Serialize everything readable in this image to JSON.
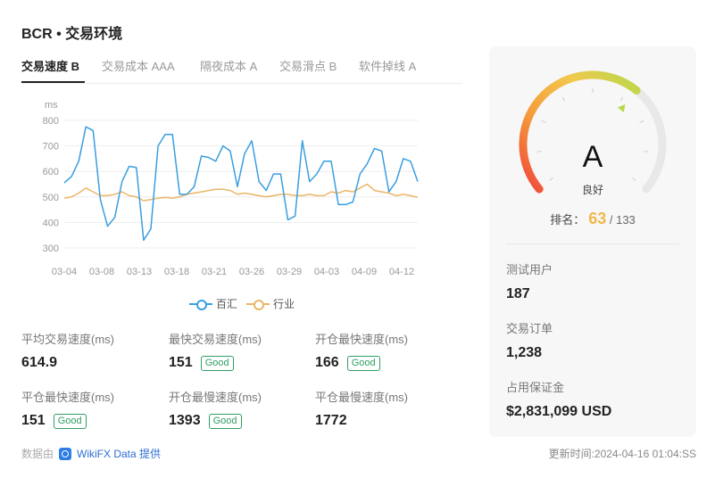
{
  "header": {
    "title": "BCR • 交易环境"
  },
  "tabs": [
    {
      "label": "交易速度 B",
      "active": true
    },
    {
      "label": "交易成本 AAA",
      "active": false
    },
    {
      "label": "隔夜成本 A",
      "active": false
    },
    {
      "label": "交易滑点 B",
      "active": false
    },
    {
      "label": "软件掉线 A",
      "active": false
    }
  ],
  "chart_data": {
    "type": "line",
    "ylabel": "ms",
    "ylim": [
      300,
      800
    ],
    "yticks": [
      800,
      700,
      600,
      500,
      400,
      300
    ],
    "xtick_labels": [
      "03-04",
      "03-08",
      "03-13",
      "03-18",
      "03-21",
      "03-26",
      "03-29",
      "04-03",
      "04-09",
      "04-12"
    ],
    "grid": "horizontal",
    "legend_position": "bottom",
    "series": [
      {
        "name": "百汇",
        "color": "#3a9ee0",
        "values": [
          555,
          580,
          640,
          775,
          760,
          490,
          385,
          420,
          560,
          620,
          615,
          330,
          375,
          700,
          745,
          745,
          510,
          510,
          540,
          660,
          655,
          640,
          700,
          680,
          540,
          670,
          720,
          560,
          525,
          590,
          590,
          410,
          425,
          720,
          560,
          590,
          640,
          640,
          470,
          470,
          480,
          590,
          630,
          690,
          680,
          520,
          560,
          650,
          640,
          560
        ]
      },
      {
        "name": "行业",
        "color": "#ebb666",
        "values": [
          495,
          500,
          515,
          535,
          520,
          505,
          505,
          510,
          520,
          505,
          500,
          485,
          490,
          495,
          498,
          495,
          500,
          510,
          515,
          520,
          525,
          530,
          530,
          525,
          510,
          515,
          510,
          505,
          500,
          505,
          510,
          510,
          505,
          505,
          510,
          505,
          505,
          520,
          515,
          525,
          520,
          535,
          550,
          525,
          520,
          515,
          505,
          510,
          505,
          498
        ]
      }
    ]
  },
  "stats": [
    {
      "label": "平均交易速度(ms)",
      "value": "614.9",
      "badge": ""
    },
    {
      "label": "最快交易速度(ms)",
      "value": "151",
      "badge": "Good"
    },
    {
      "label": "开仓最快速度(ms)",
      "value": "166",
      "badge": "Good"
    },
    {
      "label": "平仓最快速度(ms)",
      "value": "151",
      "badge": "Good"
    },
    {
      "label": "开仓最慢速度(ms)",
      "value": "1393",
      "badge": "Good"
    },
    {
      "label": "平仓最慢速度(ms)",
      "value": "1772",
      "badge": ""
    }
  ],
  "footer": {
    "source_prefix": "数据由",
    "brand": "WikiFX Data",
    "source_suffix": "提供",
    "update_time": "更新时间:2024-04-16 01:04:SS"
  },
  "panel": {
    "gauge_fraction": 0.65,
    "grade": "A",
    "grade_text": "良好",
    "rank_label": "排名：",
    "rank": "63",
    "rank_total": "/ 133",
    "stats": [
      {
        "label": "测试用户",
        "value": "187"
      },
      {
        "label": "交易订单",
        "value": "1,238"
      },
      {
        "label": "占用保证金",
        "value": "$2,831,099 USD"
      }
    ]
  },
  "colors": {
    "accent": "#3a9ee0",
    "industry": "#ebb666",
    "good": "#2f9e63",
    "rank": "#f0b84b"
  }
}
